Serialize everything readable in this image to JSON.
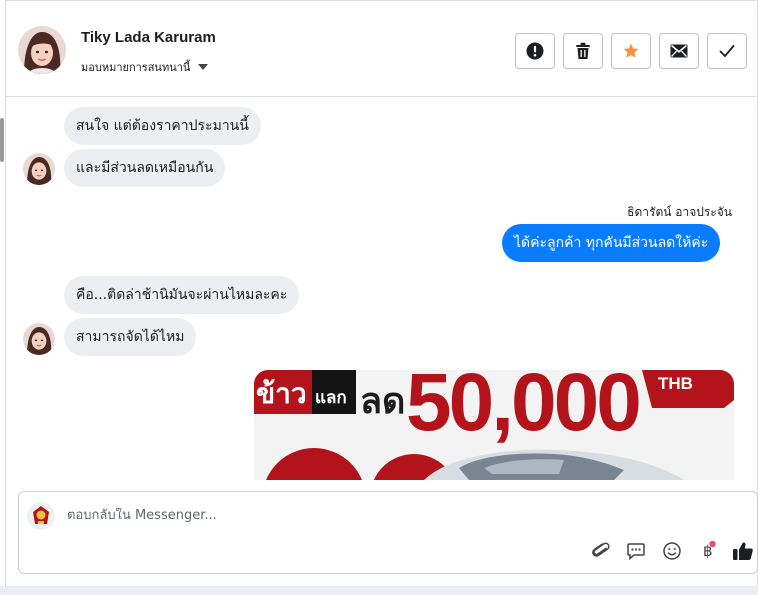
{
  "header": {
    "contact_name": "Tiky Lada Karuram",
    "assign_label": "มอบหมายการสนทนานี้",
    "buttons": [
      {
        "name": "report-button",
        "icon": "alert-circle-icon"
      },
      {
        "name": "delete-button",
        "icon": "trash-icon"
      },
      {
        "name": "star-button",
        "icon": "star-icon"
      },
      {
        "name": "mark-unread-button",
        "icon": "envelope-icon"
      },
      {
        "name": "mark-done-button",
        "icon": "check-icon"
      }
    ]
  },
  "messages": [
    {
      "from": "contact",
      "text": "สนใจ แต่ต้องราคาประมานนี้"
    },
    {
      "from": "contact",
      "text": "และมีส่วนลดเหมือนกัน"
    },
    {
      "from": "page",
      "sender": "ธิดารัตน์ อาจประจัน",
      "text": "ได้ค่ะลูกค้า ทุกคันมีส่วนลดให้ค่ะ"
    },
    {
      "from": "contact",
      "text": "คือ...ติดล่าช้านิมันจะผ่านไหมละคะ"
    },
    {
      "from": "contact",
      "text": "สามารถจัดได้ไหม"
    }
  ],
  "promo": {
    "word1": "ข้าว",
    "word2": "แลก",
    "word3": "ลด",
    "amount": "50,000",
    "currency": "THB"
  },
  "composer": {
    "placeholder": "ตอบกลับใน Messenger...",
    "tools": [
      "paperclip-icon",
      "chat-bubble-icon",
      "smiley-icon",
      "baht-icon",
      "thumbs-up-icon"
    ]
  },
  "colors": {
    "accent": "#0a7cff",
    "star": "#f7923a",
    "promo_red": "#b3131a"
  }
}
